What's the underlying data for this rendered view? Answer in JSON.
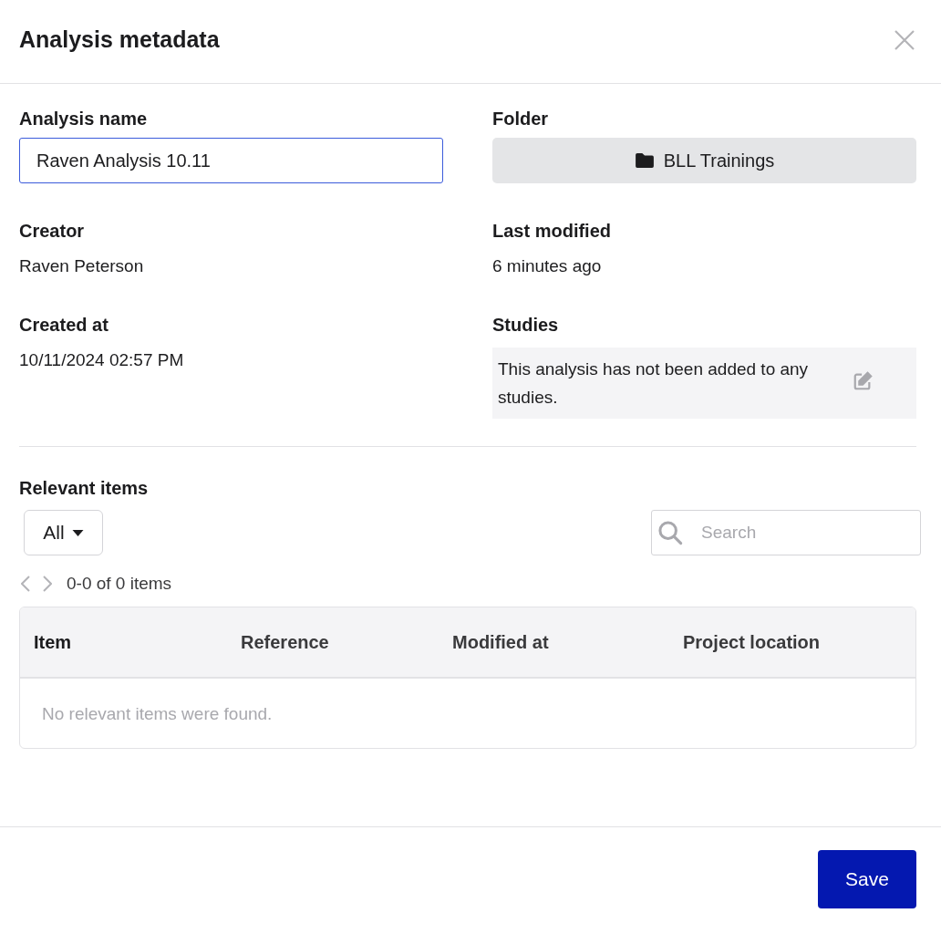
{
  "dialog": {
    "title": "Analysis metadata"
  },
  "fields": [
    {
      "kind": "input",
      "label": "Analysis name",
      "value": "Raven Analysis 10.11"
    },
    {
      "kind": "folder",
      "label": "Folder",
      "value": "BLL Trainings"
    },
    {
      "kind": "text",
      "label": "Creator",
      "value": "Raven Peterson"
    },
    {
      "kind": "text",
      "label": "Last modified",
      "value": "6 minutes ago"
    },
    {
      "kind": "text",
      "label": "Created at",
      "value": "10/11/2024 02:57 PM"
    },
    {
      "kind": "studies",
      "label": "Studies",
      "value": "This analysis has not been added to any studies."
    }
  ],
  "relevant_items": {
    "title": "Relevant items",
    "filter": "All",
    "search": {
      "placeholder": "Search"
    },
    "pager": {
      "prev_disabled": true,
      "next_disabled": true,
      "summary": "0-0 of 0 items"
    },
    "table": {
      "columns": [
        "Item",
        "Reference",
        "Modified at",
        "Project location"
      ],
      "empty_text": "No relevant items were found."
    }
  },
  "footer": {
    "save": "Save"
  }
}
